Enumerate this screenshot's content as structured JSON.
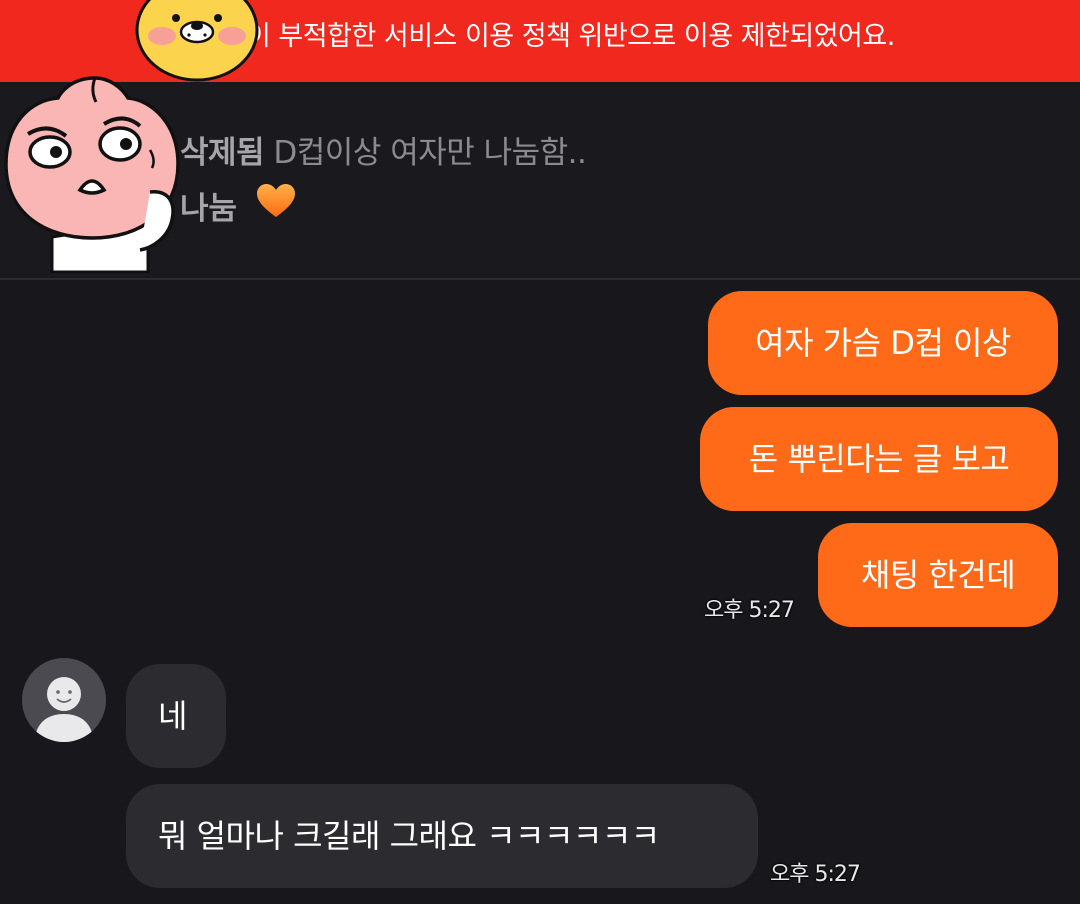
{
  "banner": {
    "text": "이 부적합한 서비스 이용 정책 위반으로 이용 제한되었어요.",
    "color": "#f0281e"
  },
  "listing": {
    "status": "삭제됨",
    "title": "D컵이상 여자만 나눔함..",
    "type": "나눔",
    "type_icon": "orange-heart-icon"
  },
  "messages": [
    {
      "from": "me",
      "text": "여자 가슴 D컵 이상"
    },
    {
      "from": "me",
      "text": "돈 뿌린다는 글 보고"
    },
    {
      "from": "me",
      "text": "채팅 한건데",
      "time": "오후 5:27"
    },
    {
      "from": "other",
      "text": "네"
    },
    {
      "from": "other",
      "text": "뭐 얼마나 크길래 그래요 ㅋㅋㅋㅋㅋㅋ",
      "time": "오후 5:27"
    }
  ],
  "colors": {
    "background": "#18181c",
    "my_bubble": "#ff6a19",
    "other_bubble": "#2b2b30"
  }
}
